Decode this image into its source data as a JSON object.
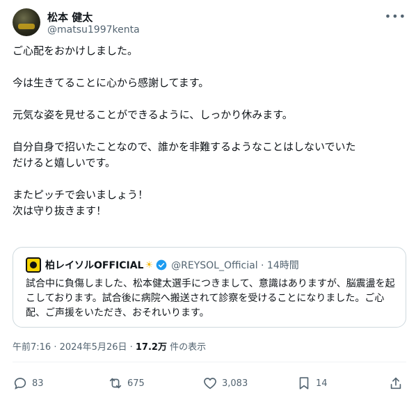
{
  "tweet": {
    "author_name": "松本 健太",
    "author_handle": "@matsu1997kenta",
    "more_icon": "more-icon",
    "lines": [
      "ご心配をおかけしました。",
      "",
      "今は生きてることに心から感謝してます。",
      "",
      "元気な姿を見せることができるように、しっかり休みます。",
      "",
      "自分自身で招いたことなので、誰かを非難するようなことはしないでいた",
      "だけると嬉しいです。",
      "",
      "またピッチで会いましょう！",
      "次は守り抜きます！"
    ]
  },
  "quote": {
    "name": "柏レイソルOFFICIAL",
    "sun": "☀",
    "handle_time": "@REYSOL_Official · 14時間",
    "text": "試合中に負傷しました、松本健太選手につきまして、意識はありますが、脳震盪を起こしております。試合後に病院へ搬送されて診察を受けることになりました。ご心配、ご声援をいただき、おそれいります。"
  },
  "meta": {
    "timestamp": "午前7:16 · 2024年5月26日 · ",
    "views_count": "17.2万",
    "views_label": " 件の表示"
  },
  "actions": {
    "replies": "83",
    "reposts": "675",
    "likes": "3,083",
    "bookmarks": "14"
  },
  "colors": {
    "text": "#0f1419",
    "secondary": "#536471",
    "border": "#cfd9de",
    "verified": "#1d9bf0",
    "quote_logo": "#f5d300"
  }
}
